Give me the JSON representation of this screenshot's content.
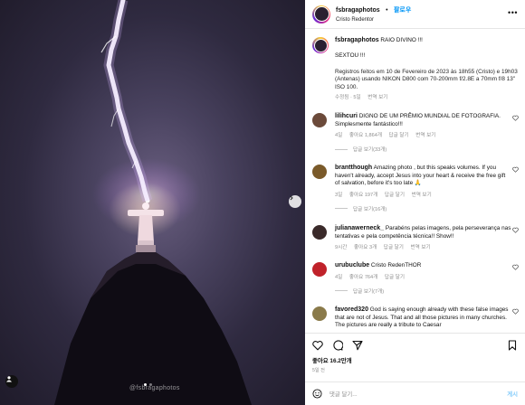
{
  "post": {
    "username": "fsbragaphotos",
    "location": "Cristo Redentor",
    "follow_label": "팔로우",
    "more_label": "•••",
    "watermark": "@fsbragaphotos"
  },
  "caption": {
    "username": "fsbragaphotos",
    "title": "RAIO DIVINO !!!",
    "line1": "SEXTOU !!!",
    "line2": "Registros feitos em 10 de Fevereiro de 2023 às 18h55 (Cristo) e 19h03 (Antenas) usando NIKON D800 com 70-200mm f/2.8E a 70mm f/8 13\" ISO 100.",
    "edited": "수정됨 · 5일",
    "translate": "번역 보기"
  },
  "comments": [
    {
      "username": "lilihcuri",
      "text": "DIGNO DE UM PRÊMIO MUNDIAL DE FOTOGRAFIA. Simplesmente fantástico!!!",
      "time": "4일",
      "likes": "좋아요 1,864개",
      "reply": "답글 달기",
      "translate": "번역 보기",
      "replies": "답글 보기(33개)",
      "avatar_color": "#6b4a3a"
    },
    {
      "username": "brantthough",
      "text": "Amazing photo , but this speaks volumes. If you haven't already, accept Jesus into your heart & receive the free gift of salvation, before it's too late",
      "time": "3일",
      "likes": "좋아요 197개",
      "reply": "답글 달기",
      "translate": "번역 보기",
      "replies": "답글 보기(16개)",
      "avatar_color": "#7a5a2a"
    },
    {
      "username": "julianawerneck_",
      "text": "Parabéns pelas imagens, pela perseverança nas tentativas e pela competência técnica!! Show!!",
      "time": "9시간",
      "likes": "좋아요 3개",
      "reply": "답글 달기",
      "translate": "번역 보기",
      "replies": "",
      "avatar_color": "#3a2a2a"
    },
    {
      "username": "urubuclube",
      "text": "Cristo RedenTHOR",
      "time": "4일",
      "likes": "좋아요 764개",
      "reply": "답글 달기",
      "translate": "",
      "replies": "답글 보기(7개)",
      "avatar_color": "#c0222a"
    },
    {
      "username": "favored320",
      "text": "God is saying enough already with these false images that are not of Jesus. That and all those pictures in many churches. The pictures are really a tribute to Caesar",
      "time": "",
      "likes": "",
      "reply": "",
      "translate": "",
      "replies": "",
      "avatar_color": "#8a7a4a"
    }
  ],
  "footer": {
    "likes": "좋아요 16.2만개",
    "date": "5일 전",
    "comment_placeholder": "댓글 달기...",
    "post_label": "게시"
  },
  "colors": {
    "accent": "#0095f6",
    "muted": "#8e8e8e",
    "like_red": "#ed4956"
  },
  "icons": [
    "heart-icon",
    "comment-icon",
    "share-icon",
    "bookmark-icon",
    "emoji-icon",
    "next-arrow-icon",
    "user-tag-icon",
    "more-icon"
  ]
}
